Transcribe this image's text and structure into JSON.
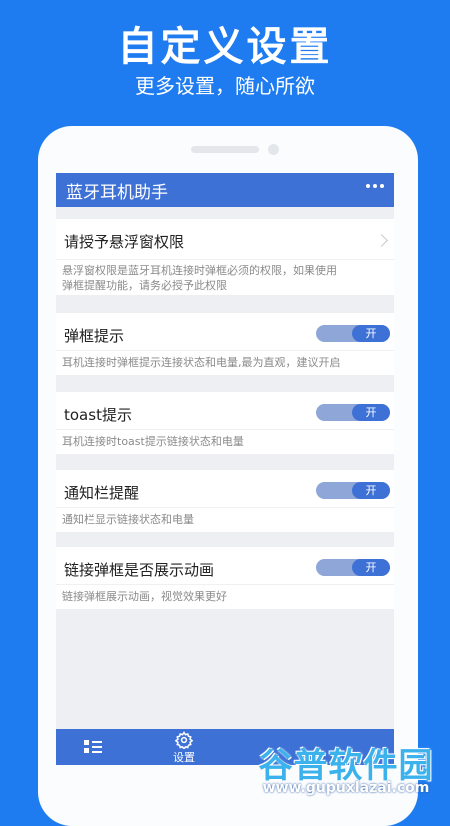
{
  "promo": {
    "title": "自定义设置",
    "subtitle": "更多设置，随心所欲"
  },
  "app": {
    "title": "蓝牙耳机助手",
    "menu_icon": "more-dots-icon"
  },
  "permission": {
    "title": "请授予悬浮窗权限",
    "desc_line1": "悬浮窗权限是蓝牙耳机连接时弹框必须的权限，如果使用",
    "desc_line2": "弹框提醒功能，请务必授予此权限"
  },
  "settings": [
    {
      "title": "弹框提示",
      "toggle_label": "开",
      "enabled": true,
      "desc": "耳机连接时弹框提示连接状态和电量,最为直观，建议开启"
    },
    {
      "title": "toast提示",
      "toggle_label": "开",
      "enabled": true,
      "desc": "耳机连接时toast提示链接状态和电量"
    },
    {
      "title": "通知栏提醒",
      "toggle_label": "开",
      "enabled": true,
      "desc": "通知栏显示链接状态和电量"
    },
    {
      "title": "链接弹框是否展示动画",
      "toggle_label": "开",
      "enabled": true,
      "desc": "链接弹框展示动画，视觉效果更好"
    }
  ],
  "bottom_nav": {
    "list_icon": "list-icon",
    "settings_icon": "gear-icon",
    "settings_label": "设置"
  },
  "watermark": {
    "logo": "谷普软件园",
    "url": "www.gupuxlazai.com"
  },
  "colors": {
    "background": "#1f7cf0",
    "accent": "#3e71d6"
  }
}
